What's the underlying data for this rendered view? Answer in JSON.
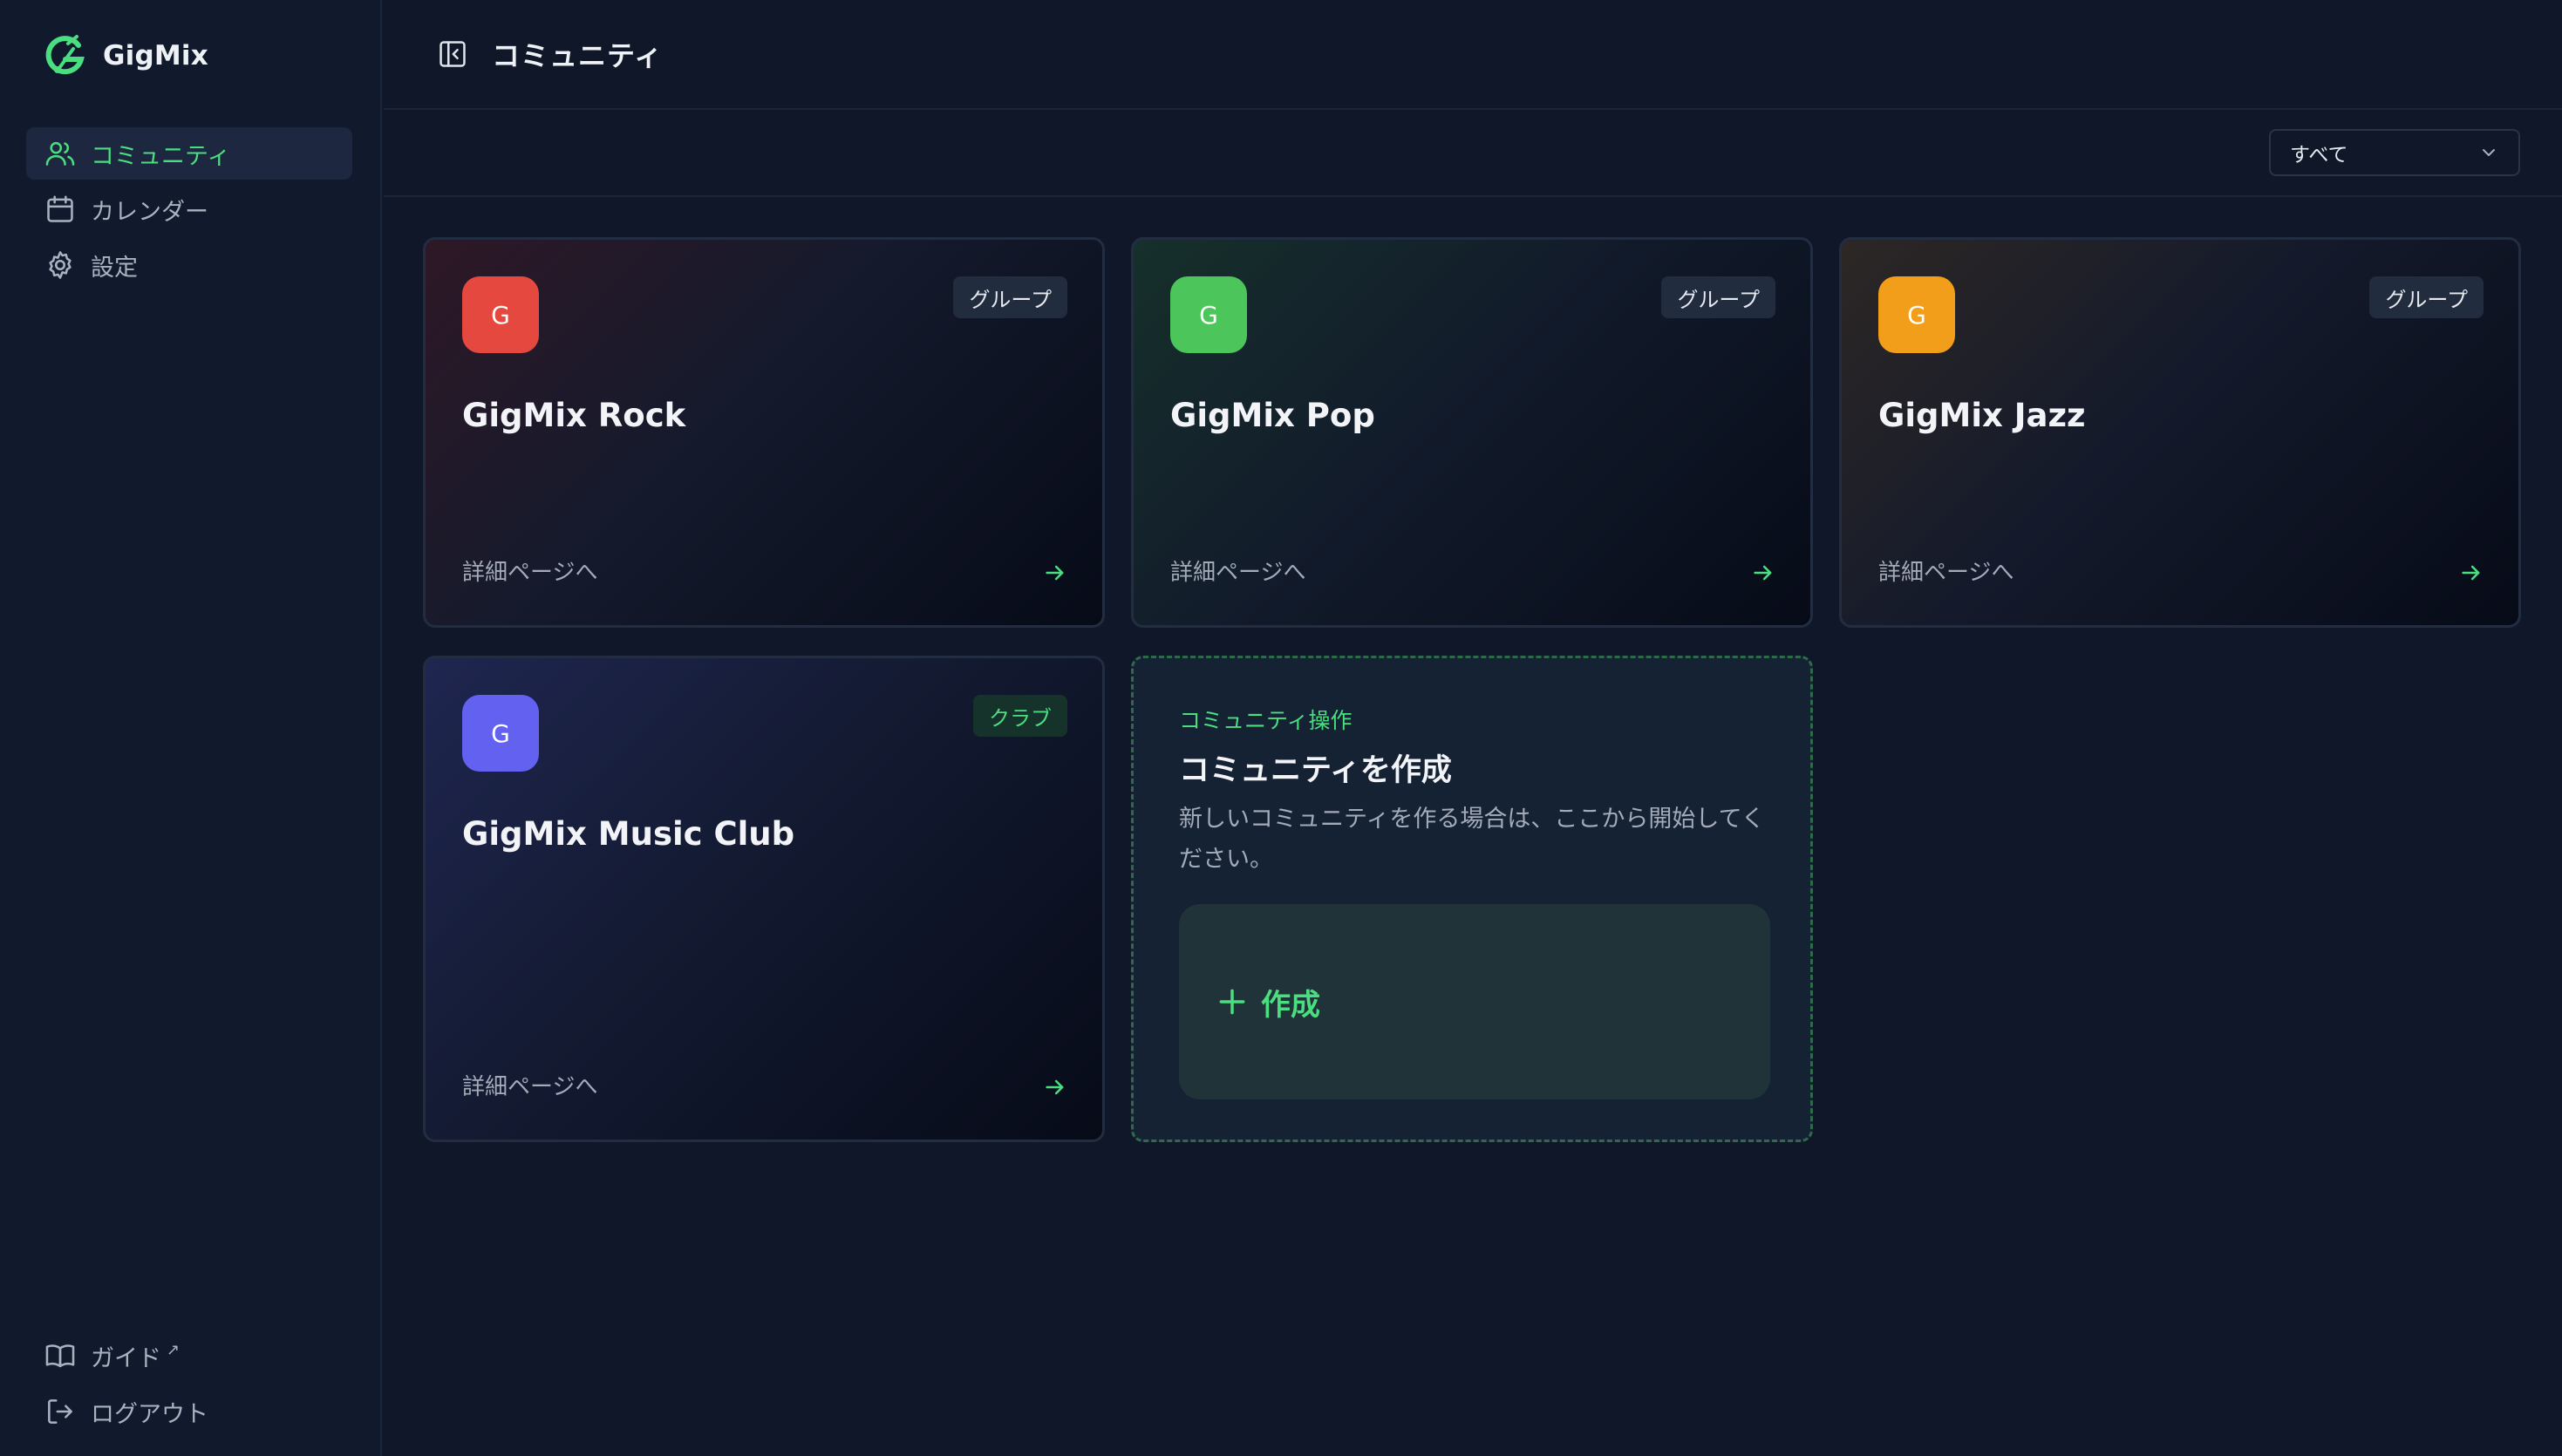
{
  "brand": {
    "name": "GigMix"
  },
  "sidebar": {
    "items": [
      {
        "label": "コミュニティ",
        "icon": "users-icon",
        "active": true
      },
      {
        "label": "カレンダー",
        "icon": "calendar-icon",
        "active": false
      },
      {
        "label": "設定",
        "icon": "gear-icon",
        "active": false
      }
    ],
    "bottom": [
      {
        "label": "ガイド",
        "icon": "book-icon",
        "external_mark": "↗"
      },
      {
        "label": "ログアウト",
        "icon": "logout-icon"
      }
    ]
  },
  "header": {
    "title": "コミュニティ",
    "toggle_icon": "sidebar-toggle-icon"
  },
  "filter": {
    "selected": "すべて"
  },
  "communities": [
    {
      "initial": "G",
      "name": "GigMix Rock",
      "type": "グループ",
      "color": "#e5483f",
      "link": "詳細ページへ"
    },
    {
      "initial": "G",
      "name": "GigMix Pop",
      "type": "グループ",
      "color": "#4cc55a",
      "link": "詳細ページへ"
    },
    {
      "initial": "G",
      "name": "GigMix Jazz",
      "type": "グループ",
      "color": "#f29e1a",
      "link": "詳細ページへ"
    },
    {
      "initial": "G",
      "name": "GigMix Music Club",
      "type": "クラブ",
      "color": "#6361f0",
      "link": "詳細ページへ"
    }
  ],
  "create": {
    "eyebrow": "コミュニティ操作",
    "title": "コミュニティを作成",
    "description": "新しいコミュニティを作る場合は、ここから開始してください。",
    "button_label": "作成"
  },
  "colors": {
    "accent": "#4ade80",
    "background": "#0f1729",
    "sidebar": "#111a2d"
  }
}
